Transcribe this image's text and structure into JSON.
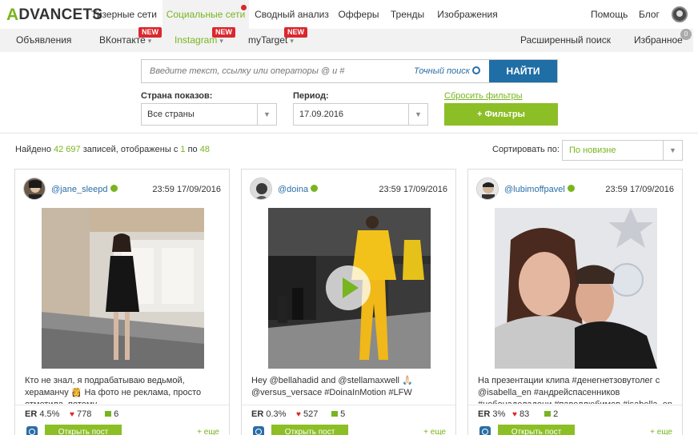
{
  "brand": {
    "logo_text": "DVANCETS",
    "logo_mark": "A"
  },
  "topnav": {
    "items": [
      "Тизерные сети",
      "Социальные сети",
      "Сводный анализ",
      "Офферы",
      "Тренды",
      "Изображения"
    ],
    "active_index": 1,
    "help": "Помощь",
    "blog": "Блог"
  },
  "subnav": {
    "items": [
      {
        "label": "Объявления",
        "badge": ""
      },
      {
        "label": "ВКонтакте",
        "badge": "NEW"
      },
      {
        "label": "Instagram",
        "badge": "NEW"
      },
      {
        "label": "myTarget",
        "badge": "NEW"
      }
    ],
    "advanced_search": "Расширенный поиск",
    "favorites": "Избранное",
    "favorites_count": "0"
  },
  "search": {
    "placeholder": "Введите текст, ссылку или операторы @ и #",
    "exact_label": "Точный поиск",
    "button": "НАЙТИ"
  },
  "filters": {
    "country_label": "Страна показов:",
    "country_value": "Все страны",
    "period_label": "Период:",
    "period_value": "17.09.2016",
    "reset": "Сбросить фильтры",
    "more_filters": "+ Фильтры"
  },
  "results": {
    "prefix": "Найдено",
    "total": "42 697",
    "middle": "записей, отображены с",
    "from": "1",
    "to_word": "по",
    "to": "48",
    "sort_label": "Сортировать по:",
    "sort_value": "По новизне"
  },
  "cards": [
    {
      "user": "@jane_sleepd",
      "time": "23:59 17/09/2016",
      "text": "Кто не знал, я подрабатываю ведьмой, хераманчу 👸 На фото не реклама, просто отметила, потому",
      "er": "4.5%",
      "likes": "778",
      "comments": "6",
      "open": "Открыть пост",
      "more": "+ еще"
    },
    {
      "user": "@doina",
      "time": "23:59 17/09/2016",
      "text": "Hey @bellahadid and @stellamaxwell 🙏🏻 @versus_versace #DoinaInMotion #LFW",
      "er": "0.3%",
      "likes": "527",
      "comments": "5",
      "open": "Открыть пост",
      "more": "+ еще"
    },
    {
      "user": "@lubimoffpavel",
      "time": "23:59 17/09/2016",
      "text": "На презентации клипа #денегнетзовутолег с @isabella_en #андрейспасенников #небонаделадони #павеллюбимов #isabella_en",
      "er": "3%",
      "likes": "83",
      "comments": "2",
      "open": "Открыть пост",
      "more": "+ еще"
    }
  ],
  "er_label": "ER",
  "colors": {
    "accent": "#78b51e",
    "primary": "#1f6ea6",
    "badge": "#d9282f"
  }
}
